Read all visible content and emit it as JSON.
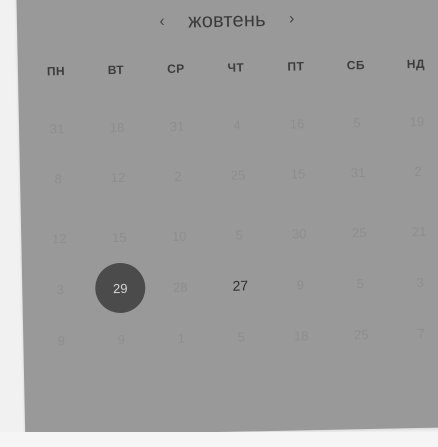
{
  "calendar": {
    "month_label": "жовтень",
    "prev_symbol": "‹",
    "next_symbol": "›",
    "weekdays": [
      "ПН",
      "ВТ",
      "СР",
      "ЧТ",
      "ПТ",
      "СБ",
      "НД"
    ],
    "weeks": [
      [
        "31",
        "18",
        "31",
        "4",
        "16",
        "5",
        "19"
      ],
      [
        "8",
        "12",
        "2",
        "25",
        "15",
        "31",
        "2"
      ],
      [
        "12",
        "15",
        "10",
        "5",
        "30",
        "25",
        "21"
      ],
      [
        "3",
        "29",
        "28",
        "27",
        "9",
        "5",
        "3"
      ],
      [
        "9",
        "9",
        "1",
        "5",
        "18",
        "25",
        "7"
      ]
    ],
    "selected_day": "29",
    "today_day": "27"
  },
  "colors": {
    "page_background": "#f1f1f1",
    "card_background": "#999999",
    "selected_circle": "#4b4b4b",
    "muted_text": "#8e8e8e",
    "strong_text": "#2f2f2f"
  }
}
